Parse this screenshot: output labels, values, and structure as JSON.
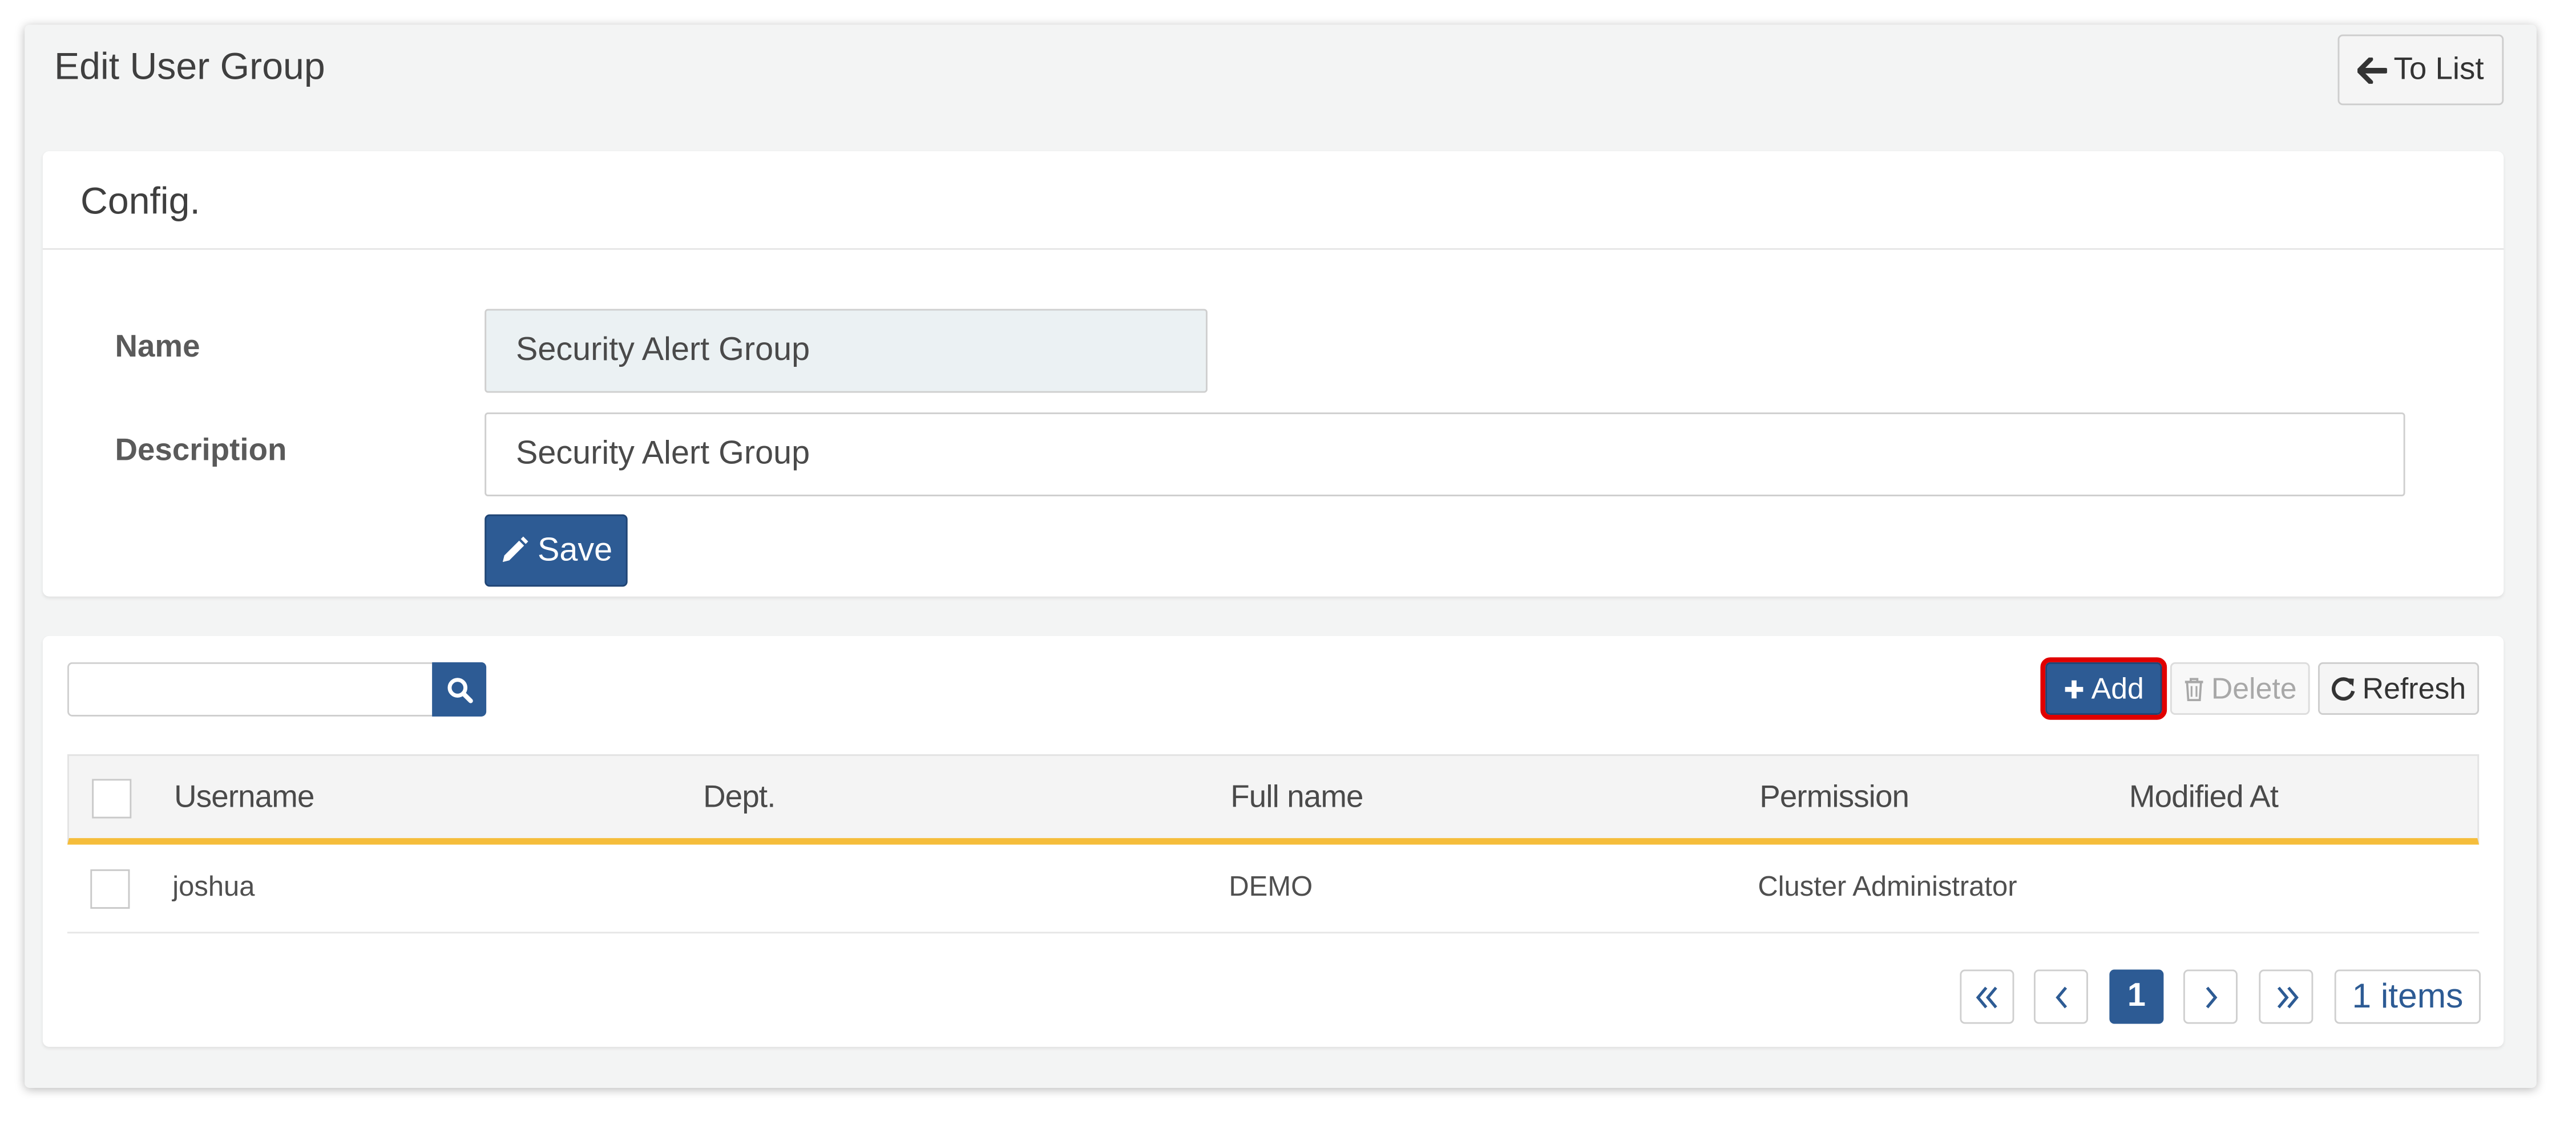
{
  "header": {
    "title": "Edit User Group",
    "to_list_label": "To List",
    "to_list_icon": "arrow-left-icon"
  },
  "config": {
    "title": "Config.",
    "name_label": "Name",
    "name_value": "Security Alert Group",
    "description_label": "Description",
    "description_value": "Security Alert Group",
    "save_label": "Save",
    "save_icon": "pencil-icon"
  },
  "list": {
    "search_value": "",
    "search_icon": "search-icon",
    "add_label": "Add",
    "delete_label": "Delete",
    "refresh_label": "Refresh",
    "columns": [
      "Username",
      "Dept.",
      "Full name",
      "Permission",
      "Modified At"
    ],
    "rows": [
      {
        "username": "joshua",
        "dept": "",
        "full_name": "DEMO",
        "permission": "Cluster Administrator",
        "modified_at": ""
      }
    ]
  },
  "pagination": {
    "first_icon": "double-chevron-left-icon",
    "prev_icon": "chevron-left-icon",
    "current_page": "1",
    "next_icon": "chevron-right-icon",
    "last_icon": "double-chevron-right-icon",
    "items_label": "1 items"
  },
  "colors": {
    "primary": "#2d5b94",
    "header_underline": "#f5bd3b",
    "highlight_outline": "#e00000",
    "background": "#f3f4f4"
  }
}
